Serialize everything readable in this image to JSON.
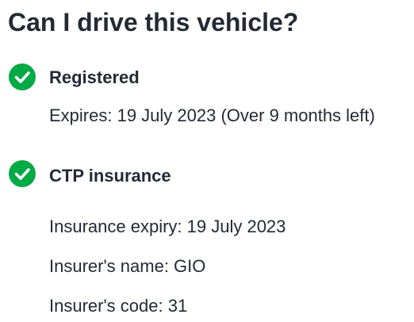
{
  "page": {
    "title": "Can I drive this vehicle?"
  },
  "registration": {
    "icon": "check-circle-icon",
    "status_color": "#00aa45",
    "heading": "Registered",
    "expires": "Expires: 19 July 2023 (Over 9 months left)"
  },
  "ctp": {
    "icon": "check-circle-icon",
    "status_color": "#00aa45",
    "heading": "CTP insurance",
    "insurance_expiry": "Insurance expiry: 19 July 2023",
    "insurer_name": "Insurer's name: GIO",
    "insurer_code": "Insurer's code: 31"
  }
}
